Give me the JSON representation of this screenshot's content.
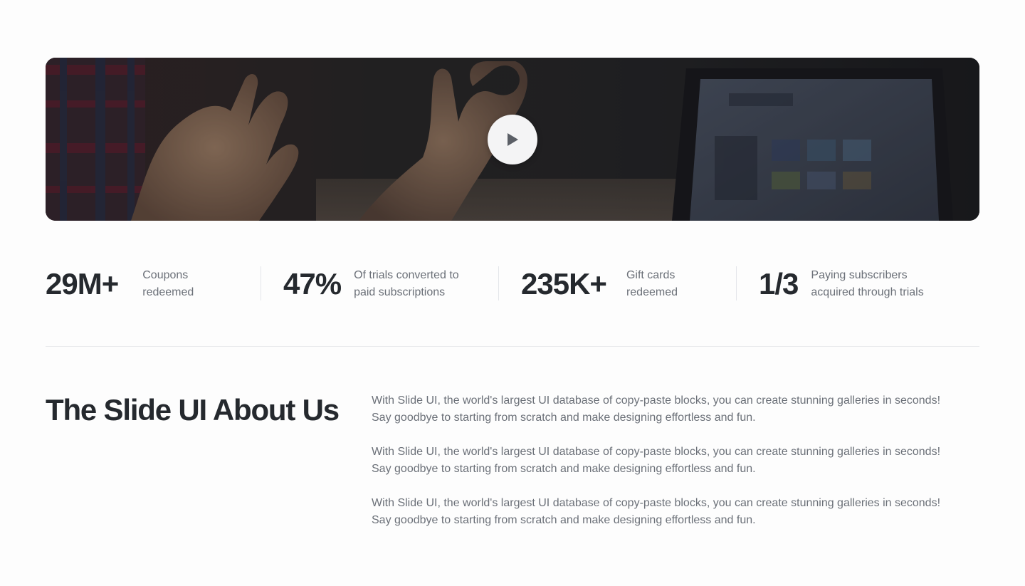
{
  "video": {
    "play_icon": "play-icon",
    "button_color": "#f4f4f5"
  },
  "stats": [
    {
      "value": "29M+",
      "label": "Coupons\nredeemed"
    },
    {
      "value": "47%",
      "label": "Of trials converted to\npaid subscriptions"
    },
    {
      "value": "235K+",
      "label": "Gift cards\nredeemed"
    },
    {
      "value": "1/3",
      "label": "Paying subscribers\nacquired through trials"
    }
  ],
  "about": {
    "title": "The Slide UI About Us",
    "paragraphs": [
      "With Slide UI, the world's largest UI database of copy-paste blocks, you can create stunning galleries in seconds!\nSay goodbye to starting from scratch and make designing effortless and fun.",
      "With Slide UI, the world's largest UI database of copy-paste blocks, you can create stunning galleries in seconds!\nSay goodbye to starting from scratch and make designing effortless and fun.",
      "With Slide UI, the world's largest UI database of copy-paste blocks, you can create stunning galleries in seconds!\nSay goodbye to starting from scratch and make designing effortless and fun."
    ]
  },
  "colors": {
    "heading": "#25292e",
    "muted_text": "#6b7078",
    "divider": "#e4e6ea"
  }
}
